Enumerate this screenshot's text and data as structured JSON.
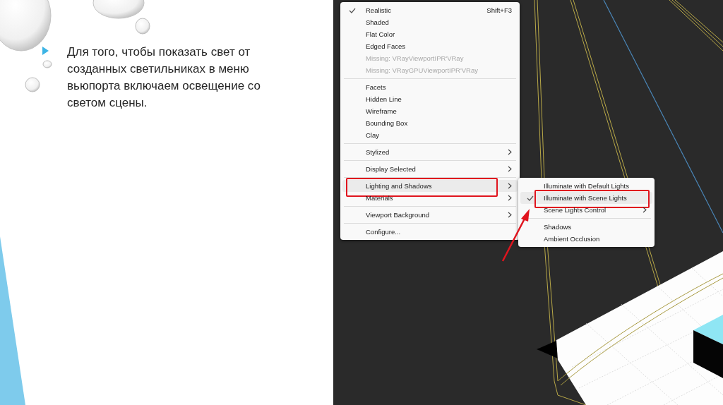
{
  "slide": {
    "text": "Для того, чтобы показать свет от созданных светильниках в меню вьюпорта включаем освещение со светом сцены."
  },
  "viewport_menu": {
    "groups": [
      [
        {
          "label": "Realistic",
          "shortcut": "Shift+F3",
          "checked": true,
          "disabled": false,
          "submenu": false,
          "highlighted": false,
          "annotated": false
        },
        {
          "label": "Shaded",
          "checked": false,
          "disabled": false,
          "submenu": false,
          "highlighted": false,
          "annotated": false
        },
        {
          "label": "Flat Color",
          "checked": false,
          "disabled": false,
          "submenu": false,
          "highlighted": false,
          "annotated": false
        },
        {
          "label": "Edged Faces",
          "checked": false,
          "disabled": false,
          "submenu": false,
          "highlighted": false,
          "annotated": false
        },
        {
          "label": "Missing: VRayViewportIPR'VRay",
          "checked": false,
          "disabled": true,
          "submenu": false,
          "highlighted": false,
          "annotated": false
        },
        {
          "label": "Missing: VRayGPUViewportIPR'VRay",
          "checked": false,
          "disabled": true,
          "submenu": false,
          "highlighted": false,
          "annotated": false
        }
      ],
      [
        {
          "label": "Facets",
          "checked": false,
          "disabled": false,
          "submenu": false,
          "highlighted": false,
          "annotated": false
        },
        {
          "label": "Hidden Line",
          "checked": false,
          "disabled": false,
          "submenu": false,
          "highlighted": false,
          "annotated": false
        },
        {
          "label": "Wireframe",
          "checked": false,
          "disabled": false,
          "submenu": false,
          "highlighted": false,
          "annotated": false
        },
        {
          "label": "Bounding Box",
          "checked": false,
          "disabled": false,
          "submenu": false,
          "highlighted": false,
          "annotated": false
        },
        {
          "label": "Clay",
          "checked": false,
          "disabled": false,
          "submenu": false,
          "highlighted": false,
          "annotated": false
        }
      ],
      [
        {
          "label": "Stylized",
          "checked": false,
          "disabled": false,
          "submenu": true,
          "highlighted": false,
          "annotated": false
        }
      ],
      [
        {
          "label": "Display Selected",
          "checked": false,
          "disabled": false,
          "submenu": true,
          "highlighted": false,
          "annotated": false
        }
      ],
      [
        {
          "label": "Lighting and Shadows",
          "checked": false,
          "disabled": false,
          "submenu": true,
          "highlighted": true,
          "annotated": true
        },
        {
          "label": "Materials",
          "checked": false,
          "disabled": false,
          "submenu": true,
          "highlighted": false,
          "annotated": false
        }
      ],
      [
        {
          "label": "Viewport Background",
          "checked": false,
          "disabled": false,
          "submenu": true,
          "highlighted": false,
          "annotated": false
        }
      ],
      [
        {
          "label": "Configure...",
          "checked": false,
          "disabled": false,
          "submenu": false,
          "highlighted": false,
          "annotated": false
        }
      ]
    ]
  },
  "lighting_submenu": {
    "groups": [
      [
        {
          "label": "Illuminate with Default Lights",
          "checked": false,
          "disabled": false,
          "submenu": false,
          "highlighted": false,
          "annotated": false
        },
        {
          "label": "Illuminate with Scene Lights",
          "checked": true,
          "disabled": false,
          "submenu": false,
          "highlighted": true,
          "annotated": true
        },
        {
          "label": "Scene Lights Control",
          "checked": false,
          "disabled": false,
          "submenu": true,
          "highlighted": false,
          "annotated": false
        }
      ],
      [
        {
          "label": "Shadows",
          "checked": false,
          "disabled": false,
          "submenu": false,
          "highlighted": false,
          "annotated": false
        },
        {
          "label": "Ambient Occlusion",
          "checked": false,
          "disabled": false,
          "submenu": false,
          "highlighted": false,
          "annotated": false
        }
      ]
    ]
  }
}
